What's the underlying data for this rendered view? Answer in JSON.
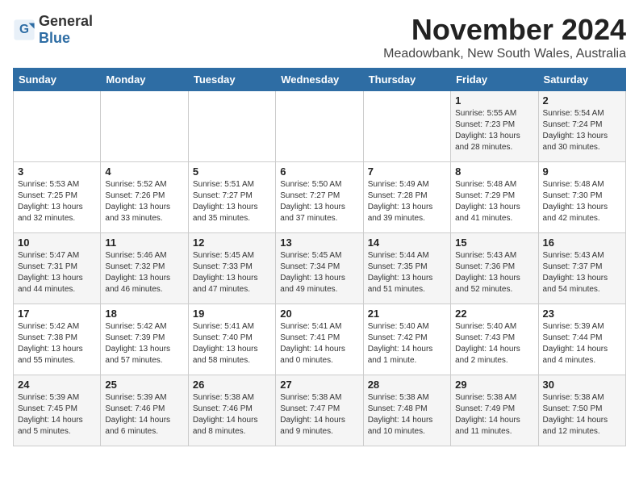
{
  "header": {
    "logo_general": "General",
    "logo_blue": "Blue",
    "month_title": "November 2024",
    "location": "Meadowbank, New South Wales, Australia"
  },
  "weekdays": [
    "Sunday",
    "Monday",
    "Tuesday",
    "Wednesday",
    "Thursday",
    "Friday",
    "Saturday"
  ],
  "weeks": [
    [
      {
        "day": "",
        "sunrise": "",
        "sunset": "",
        "daylight": ""
      },
      {
        "day": "",
        "sunrise": "",
        "sunset": "",
        "daylight": ""
      },
      {
        "day": "",
        "sunrise": "",
        "sunset": "",
        "daylight": ""
      },
      {
        "day": "",
        "sunrise": "",
        "sunset": "",
        "daylight": ""
      },
      {
        "day": "",
        "sunrise": "",
        "sunset": "",
        "daylight": ""
      },
      {
        "day": "1",
        "sunrise": "Sunrise: 5:55 AM",
        "sunset": "Sunset: 7:23 PM",
        "daylight": "Daylight: 13 hours and 28 minutes."
      },
      {
        "day": "2",
        "sunrise": "Sunrise: 5:54 AM",
        "sunset": "Sunset: 7:24 PM",
        "daylight": "Daylight: 13 hours and 30 minutes."
      }
    ],
    [
      {
        "day": "3",
        "sunrise": "Sunrise: 5:53 AM",
        "sunset": "Sunset: 7:25 PM",
        "daylight": "Daylight: 13 hours and 32 minutes."
      },
      {
        "day": "4",
        "sunrise": "Sunrise: 5:52 AM",
        "sunset": "Sunset: 7:26 PM",
        "daylight": "Daylight: 13 hours and 33 minutes."
      },
      {
        "day": "5",
        "sunrise": "Sunrise: 5:51 AM",
        "sunset": "Sunset: 7:27 PM",
        "daylight": "Daylight: 13 hours and 35 minutes."
      },
      {
        "day": "6",
        "sunrise": "Sunrise: 5:50 AM",
        "sunset": "Sunset: 7:27 PM",
        "daylight": "Daylight: 13 hours and 37 minutes."
      },
      {
        "day": "7",
        "sunrise": "Sunrise: 5:49 AM",
        "sunset": "Sunset: 7:28 PM",
        "daylight": "Daylight: 13 hours and 39 minutes."
      },
      {
        "day": "8",
        "sunrise": "Sunrise: 5:48 AM",
        "sunset": "Sunset: 7:29 PM",
        "daylight": "Daylight: 13 hours and 41 minutes."
      },
      {
        "day": "9",
        "sunrise": "Sunrise: 5:48 AM",
        "sunset": "Sunset: 7:30 PM",
        "daylight": "Daylight: 13 hours and 42 minutes."
      }
    ],
    [
      {
        "day": "10",
        "sunrise": "Sunrise: 5:47 AM",
        "sunset": "Sunset: 7:31 PM",
        "daylight": "Daylight: 13 hours and 44 minutes."
      },
      {
        "day": "11",
        "sunrise": "Sunrise: 5:46 AM",
        "sunset": "Sunset: 7:32 PM",
        "daylight": "Daylight: 13 hours and 46 minutes."
      },
      {
        "day": "12",
        "sunrise": "Sunrise: 5:45 AM",
        "sunset": "Sunset: 7:33 PM",
        "daylight": "Daylight: 13 hours and 47 minutes."
      },
      {
        "day": "13",
        "sunrise": "Sunrise: 5:45 AM",
        "sunset": "Sunset: 7:34 PM",
        "daylight": "Daylight: 13 hours and 49 minutes."
      },
      {
        "day": "14",
        "sunrise": "Sunrise: 5:44 AM",
        "sunset": "Sunset: 7:35 PM",
        "daylight": "Daylight: 13 hours and 51 minutes."
      },
      {
        "day": "15",
        "sunrise": "Sunrise: 5:43 AM",
        "sunset": "Sunset: 7:36 PM",
        "daylight": "Daylight: 13 hours and 52 minutes."
      },
      {
        "day": "16",
        "sunrise": "Sunrise: 5:43 AM",
        "sunset": "Sunset: 7:37 PM",
        "daylight": "Daylight: 13 hours and 54 minutes."
      }
    ],
    [
      {
        "day": "17",
        "sunrise": "Sunrise: 5:42 AM",
        "sunset": "Sunset: 7:38 PM",
        "daylight": "Daylight: 13 hours and 55 minutes."
      },
      {
        "day": "18",
        "sunrise": "Sunrise: 5:42 AM",
        "sunset": "Sunset: 7:39 PM",
        "daylight": "Daylight: 13 hours and 57 minutes."
      },
      {
        "day": "19",
        "sunrise": "Sunrise: 5:41 AM",
        "sunset": "Sunset: 7:40 PM",
        "daylight": "Daylight: 13 hours and 58 minutes."
      },
      {
        "day": "20",
        "sunrise": "Sunrise: 5:41 AM",
        "sunset": "Sunset: 7:41 PM",
        "daylight": "Daylight: 14 hours and 0 minutes."
      },
      {
        "day": "21",
        "sunrise": "Sunrise: 5:40 AM",
        "sunset": "Sunset: 7:42 PM",
        "daylight": "Daylight: 14 hours and 1 minute."
      },
      {
        "day": "22",
        "sunrise": "Sunrise: 5:40 AM",
        "sunset": "Sunset: 7:43 PM",
        "daylight": "Daylight: 14 hours and 2 minutes."
      },
      {
        "day": "23",
        "sunrise": "Sunrise: 5:39 AM",
        "sunset": "Sunset: 7:44 PM",
        "daylight": "Daylight: 14 hours and 4 minutes."
      }
    ],
    [
      {
        "day": "24",
        "sunrise": "Sunrise: 5:39 AM",
        "sunset": "Sunset: 7:45 PM",
        "daylight": "Daylight: 14 hours and 5 minutes."
      },
      {
        "day": "25",
        "sunrise": "Sunrise: 5:39 AM",
        "sunset": "Sunset: 7:46 PM",
        "daylight": "Daylight: 14 hours and 6 minutes."
      },
      {
        "day": "26",
        "sunrise": "Sunrise: 5:38 AM",
        "sunset": "Sunset: 7:46 PM",
        "daylight": "Daylight: 14 hours and 8 minutes."
      },
      {
        "day": "27",
        "sunrise": "Sunrise: 5:38 AM",
        "sunset": "Sunset: 7:47 PM",
        "daylight": "Daylight: 14 hours and 9 minutes."
      },
      {
        "day": "28",
        "sunrise": "Sunrise: 5:38 AM",
        "sunset": "Sunset: 7:48 PM",
        "daylight": "Daylight: 14 hours and 10 minutes."
      },
      {
        "day": "29",
        "sunrise": "Sunrise: 5:38 AM",
        "sunset": "Sunset: 7:49 PM",
        "daylight": "Daylight: 14 hours and 11 minutes."
      },
      {
        "day": "30",
        "sunrise": "Sunrise: 5:38 AM",
        "sunset": "Sunset: 7:50 PM",
        "daylight": "Daylight: 14 hours and 12 minutes."
      }
    ]
  ]
}
